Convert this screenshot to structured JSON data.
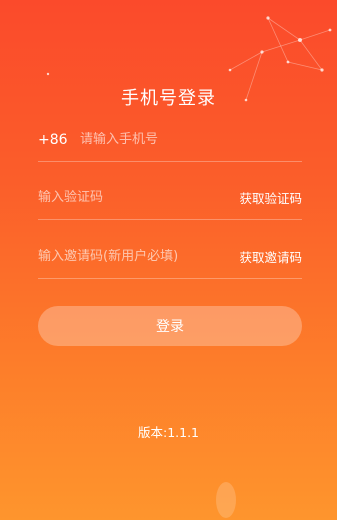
{
  "header": {
    "title": "手机号登录"
  },
  "form": {
    "country_code": "+86",
    "phone_placeholder": "请输入手机号",
    "code_placeholder": "输入验证码",
    "get_code_label": "获取验证码",
    "invite_placeholder": "输入邀请码(新用户必填)",
    "get_invite_label": "获取邀请码",
    "login_label": "登录"
  },
  "footer": {
    "version": "版本:1.1.1"
  },
  "colors": {
    "bg_top": "#fb4a2b",
    "bg_bottom": "#fe952d",
    "text": "#ffffff"
  }
}
